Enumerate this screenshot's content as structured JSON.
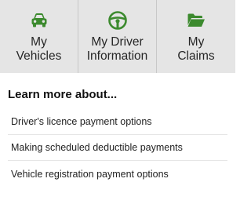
{
  "nav": {
    "tabs": [
      {
        "label_line1": "My",
        "label_line2": "Vehicles",
        "icon": "car-icon"
      },
      {
        "label_line1": "My Driver",
        "label_line2": "Information",
        "icon": "steering-wheel-icon"
      },
      {
        "label_line1": "My",
        "label_line2": "Claims",
        "icon": "folder-icon"
      }
    ]
  },
  "learn_more": {
    "title": "Learn more about...",
    "links": [
      "Driver's licence payment options",
      "Making scheduled deductible payments",
      "Vehicle registration payment options"
    ]
  },
  "colors": {
    "icon_green": "#3c8a2e",
    "tab_background": "#e5e5e5"
  }
}
